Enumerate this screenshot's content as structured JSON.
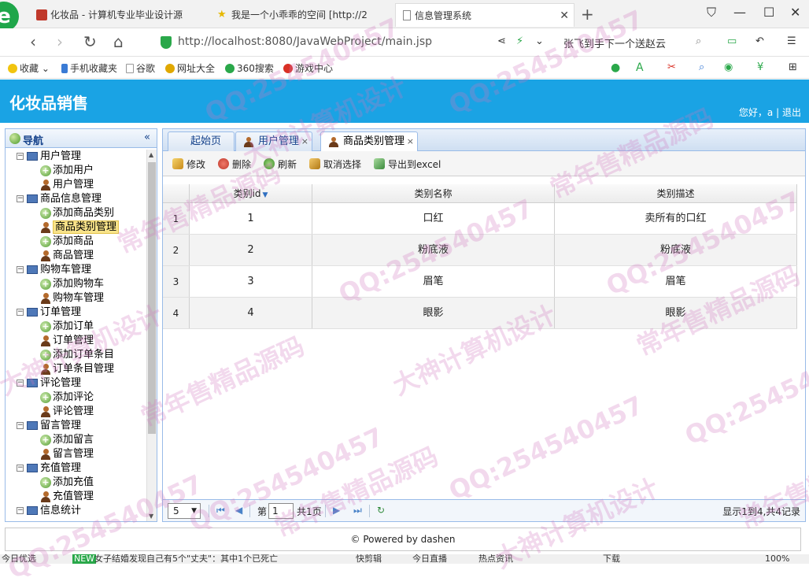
{
  "browser": {
    "tabs": [
      {
        "title": "化妆品 - 计算机专业毕业设计源",
        "active": false
      },
      {
        "title": "我是一个小乖乖的空间 [http://2",
        "active": false
      },
      {
        "title": "信息管理系统",
        "active": true
      }
    ],
    "new_tab": "+",
    "url": "http://localhost:8080/JavaWebProject/main.jsp",
    "search_hint": "张飞到手下一个送赵云",
    "bookmarks": [
      "收藏",
      "手机收藏夹",
      "谷歌",
      "网址大全",
      "360搜索",
      "游戏中心"
    ]
  },
  "app": {
    "title": "化妆品销售",
    "greeting": "您好，a",
    "separator": "|",
    "logout": "退出"
  },
  "nav": {
    "title": "导航",
    "collapse": "«",
    "groups": [
      {
        "label": "用户管理",
        "items": [
          "添加用户",
          "用户管理"
        ]
      },
      {
        "label": "商品信息管理",
        "items": [
          "添加商品类别",
          "商品类别管理",
          "添加商品",
          "商品管理"
        ]
      },
      {
        "label": "购物车管理",
        "items": [
          "添加购物车",
          "购物车管理"
        ]
      },
      {
        "label": "订单管理",
        "items": [
          "添加订单",
          "订单管理",
          "添加订单条目",
          "订单条目管理"
        ]
      },
      {
        "label": "评论管理",
        "items": [
          "添加评论",
          "评论管理"
        ]
      },
      {
        "label": "留言管理",
        "items": [
          "添加留言",
          "留言管理"
        ]
      },
      {
        "label": "充值管理",
        "items": [
          "添加充值",
          "充值管理"
        ]
      },
      {
        "label": "信息统计",
        "items": []
      }
    ],
    "selected": "商品类别管理"
  },
  "tabs": [
    {
      "label": "起始页",
      "closable": false,
      "active": false
    },
    {
      "label": "用户管理",
      "closable": true,
      "active": false
    },
    {
      "label": "商品类别管理",
      "closable": true,
      "active": true
    }
  ],
  "toolbar": {
    "edit": "修改",
    "delete": "删除",
    "refresh": "刷新",
    "cancel_select": "取消选择",
    "export": "导出到excel"
  },
  "grid": {
    "columns": [
      "类别id",
      "类别名称",
      "类别描述"
    ],
    "rows": [
      {
        "rn": "1",
        "id": "1",
        "name": "口红",
        "desc": "卖所有的口红"
      },
      {
        "rn": "2",
        "id": "2",
        "name": "粉底液",
        "desc": "粉底液"
      },
      {
        "rn": "3",
        "id": "3",
        "name": "眉笔",
        "desc": "眉笔"
      },
      {
        "rn": "4",
        "id": "4",
        "name": "眼影",
        "desc": "眼影"
      }
    ]
  },
  "pager": {
    "page_size": "5",
    "page_prefix": "第",
    "page": "1",
    "total_pages": "共1页",
    "summary": "显示1到4,共4记录"
  },
  "footer": "© Powered by dashen",
  "status": {
    "left": "今日优选",
    "news": "女子结婚发现自己有5个\"丈夫\"：其中1个已死亡",
    "items": [
      "快剪辑",
      "今日直播",
      "热点资讯",
      "下载",
      "100%"
    ]
  },
  "watermarks": [
    "QQ:254540457",
    "大神计算机设计",
    "常年售精品源码"
  ],
  "colors": {
    "header": "#1aa3e4",
    "selected_nav": "#f8e38a"
  }
}
